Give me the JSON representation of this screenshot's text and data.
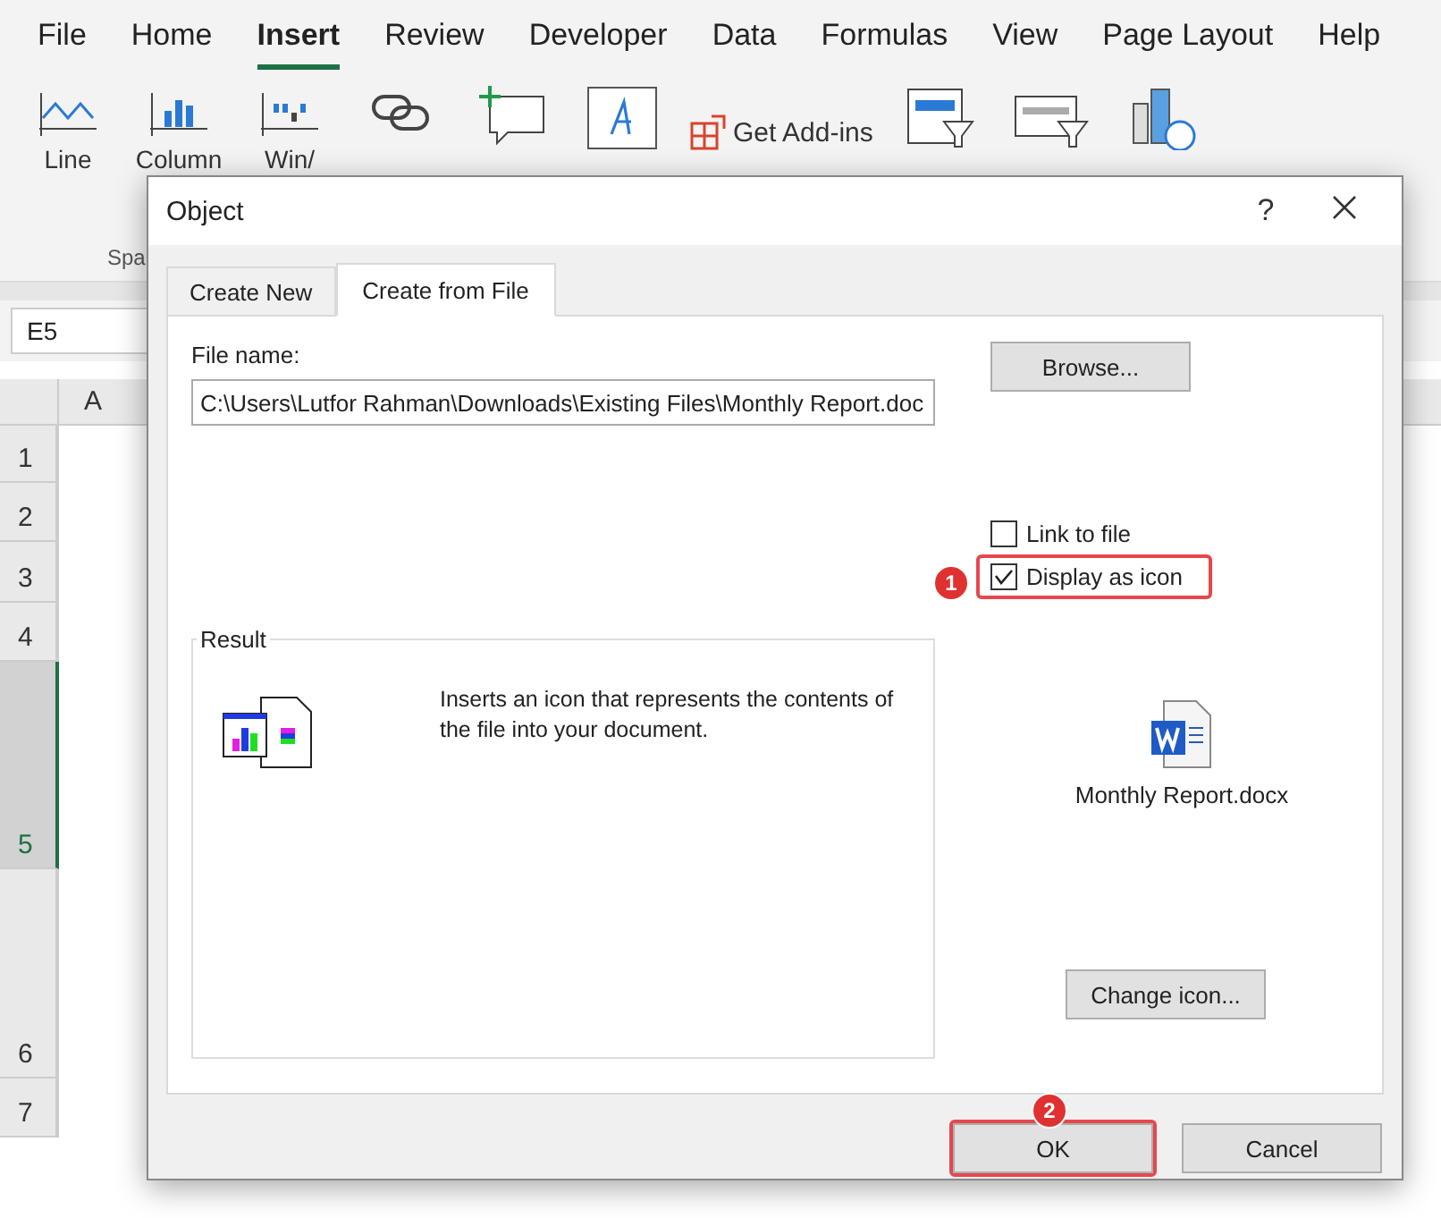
{
  "app": {
    "menu_tabs": [
      {
        "label": "File",
        "selected": false
      },
      {
        "label": "Home",
        "selected": false
      },
      {
        "label": "Insert",
        "selected": true
      },
      {
        "label": "Review",
        "selected": false
      },
      {
        "label": "Developer",
        "selected": false
      },
      {
        "label": "Data",
        "selected": false
      },
      {
        "label": "Formulas",
        "selected": false
      },
      {
        "label": "View",
        "selected": false
      },
      {
        "label": "Page Layout",
        "selected": false
      },
      {
        "label": "Help",
        "selected": false
      }
    ],
    "ribbon": [
      {
        "kind": "line",
        "label": "Line"
      },
      {
        "kind": "column",
        "label": "Column"
      },
      {
        "kind": "winloss",
        "label": "Win/"
      },
      {
        "kind": "link"
      },
      {
        "kind": "comment"
      },
      {
        "kind": "text"
      },
      {
        "kind": "addins",
        "label": "Get Add-ins"
      },
      {
        "kind": "slicer"
      },
      {
        "kind": "timeline"
      },
      {
        "kind": "map"
      }
    ],
    "group_label": "Spa",
    "name_box": "E5",
    "column_header": "A",
    "rows": [
      {
        "label": "1",
        "selected": false
      },
      {
        "label": "2",
        "selected": false
      },
      {
        "label": "3",
        "selected": false
      },
      {
        "label": "4",
        "selected": false
      },
      {
        "label": "5",
        "selected": true
      },
      {
        "label": "6",
        "selected": false
      },
      {
        "label": "7",
        "selected": false
      }
    ]
  },
  "dialog": {
    "title": "Object",
    "help": "?",
    "tabs": [
      {
        "label": "Create New",
        "selected": false
      },
      {
        "label": "Create from File",
        "selected": true
      }
    ],
    "file_name_label": "File name:",
    "file_name": "C:\\Users\\Lutfor Rahman\\Downloads\\Existing Files\\Monthly Report.doc",
    "browse": "Browse...",
    "options": [
      {
        "label": "Link to file",
        "checked": false
      },
      {
        "label": "Display as icon",
        "checked": true
      }
    ],
    "result": {
      "title": "Result",
      "text": "Inserts an icon that represents the contents of the file into your document."
    },
    "icon_caption": "Monthly Report.docx",
    "change_icon": "Change icon...",
    "buttons": [
      {
        "label": "OK"
      },
      {
        "label": "Cancel"
      }
    ]
  },
  "annotations": [
    {
      "label": "1"
    },
    {
      "label": "2"
    }
  ]
}
